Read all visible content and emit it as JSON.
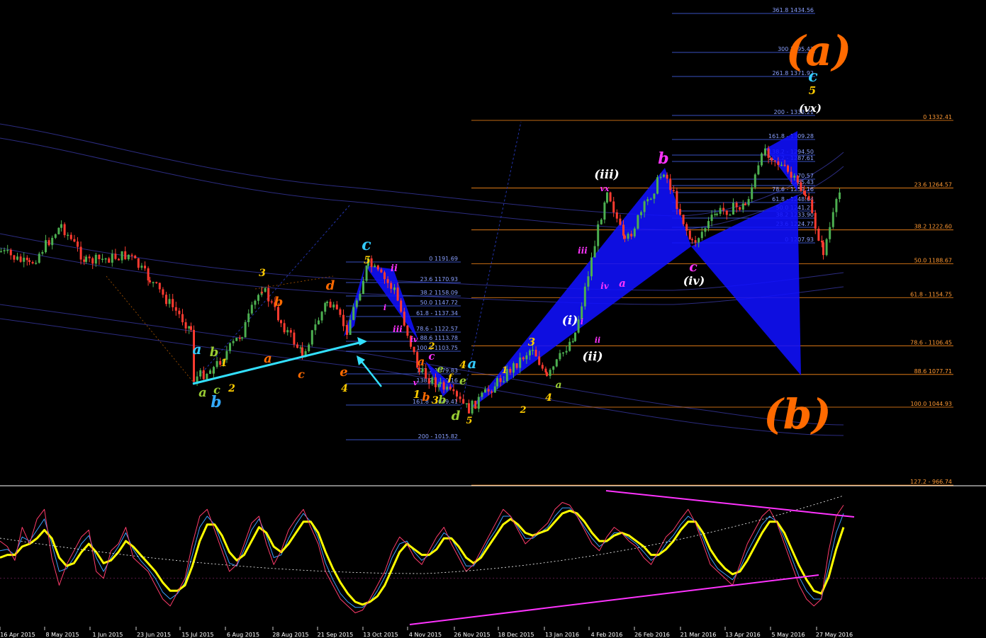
{
  "colors": {
    "background": "#000000",
    "bull_candle": "#4caf50",
    "bear_candle": "#ff3b30",
    "fib_orange": "#ff8c1a",
    "fib_blue": "#4a6cff",
    "fib_label": "#ff9933",
    "fib_label_blue": "#8aa0ff",
    "pattern_fill": "#1010ff",
    "channel": "#2a2a7a",
    "oscillator_main": "#ffff00",
    "oscillator_fast": "#3aa0ff",
    "oscillator_slow": "#ff3b6b",
    "oscillator_signal": "#ffffff",
    "divergence": "#ff33ff",
    "trend_arrow": "#33e0ff",
    "panel_divider": "#ffffff"
  },
  "chart_data": [
    {
      "type": "candlestick",
      "pane": "price",
      "y_range": [
        966,
        1434
      ],
      "big_labels": [
        {
          "text": "(a)",
          "color": "#ff6a00"
        },
        {
          "text": "(b)",
          "color": "#ff6a00"
        }
      ],
      "fib_right": [
        {
          "level": "0",
          "value": "1332.41",
          "label": "0 1332.41",
          "color": "#ff8c1a"
        },
        {
          "level": "23.6",
          "value": "1264.57",
          "label": "23.6 1264.57",
          "color": "#ff8c1a"
        },
        {
          "level": "38.2",
          "value": "1222.60",
          "label": "38.2 1222.60",
          "color": "#ff8c1a"
        },
        {
          "level": "50.0",
          "value": "1188.67",
          "label": "50.0 1188.67",
          "color": "#ff8c1a"
        },
        {
          "level": "61.8",
          "value": "1154.75",
          "label": "61.8 - 1154.75",
          "color": "#ff8c1a"
        },
        {
          "level": "78.6",
          "value": "1106.45",
          "label": "78.6 - 1106.45",
          "color": "#ff8c1a"
        },
        {
          "level": "88.6",
          "value": "1077.71",
          "label": "88.6 1077.71",
          "color": "#ff8c1a"
        },
        {
          "level": "100.0",
          "value": "1044.93",
          "label": "100.0 1044.93",
          "color": "#ff8c1a"
        },
        {
          "level": "127.2",
          "value": "966.74",
          "label": "127.2 - 966.74",
          "color": "#ff8c1a"
        }
      ],
      "fib_top": [
        {
          "label": "361.8 1434.56",
          "value": 1434.56
        },
        {
          "label": "300 1395.43",
          "value": 1395.43
        },
        {
          "label": "261.8 1371.92",
          "value": 1371.92
        },
        {
          "label": "200 - 1333.21",
          "value": 1333.21
        },
        {
          "label": "161.8 - 1309.28",
          "value": 1309.28
        },
        {
          "label": "138.2 - 1294.50",
          "value": 1294.5
        },
        {
          "label": "127.2 - 1287.61",
          "value": 1287.61
        },
        {
          "label": "1270.57",
          "value": 1270.57
        },
        {
          "label": "1265.43",
          "value": 1265.43
        },
        {
          "label": "78.6 - 1259.16",
          "value": 1259.16
        },
        {
          "label": "61.8 - 1248.64",
          "value": 1248.64
        },
        {
          "label": "50.0 1241.27",
          "value": 1241.27
        },
        {
          "label": "38.2 1233.90",
          "value": 1233.9
        },
        {
          "label": "23.6 1224.77",
          "value": 1224.77
        },
        {
          "label": "0 1207.93",
          "value": 1207.93
        }
      ],
      "fib_mid": [
        {
          "label": "0 1191.69",
          "value": 1191.69
        },
        {
          "label": "23.6 1170.93",
          "value": 1170.93
        },
        {
          "label": "38.2 1158.09",
          "value": 1158.09
        },
        {
          "label": "50.0 1147.72",
          "value": 1147.72
        },
        {
          "label": "61.8 - 1137.34",
          "value": 1137.34
        },
        {
          "label": "78.6 - 1122.57",
          "value": 1122.57
        },
        {
          "label": "88.6 1113.78",
          "value": 1113.78
        },
        {
          "label": "100.0 1103.75",
          "value": 1103.75
        },
        {
          "label": "127.2 1079.83",
          "value": 1079.83
        },
        {
          "label": "138.2 1070.16",
          "value": 1070.16
        },
        {
          "label": "161.8 - 1049.41",
          "value": 1049.41
        },
        {
          "label": "200 - 1015.82",
          "value": 1015.82
        }
      ],
      "wave_labels": [
        {
          "text": "a",
          "color": "#33ccff"
        },
        {
          "text": "b",
          "color": "#99cc33"
        },
        {
          "text": "1",
          "color": "#ffcc00"
        },
        {
          "text": "a",
          "color": "#99cc33"
        },
        {
          "text": "c",
          "color": "#99cc33"
        },
        {
          "text": "2",
          "color": "#ffcc00"
        },
        {
          "text": "b",
          "color": "#33aaff"
        },
        {
          "text": "3",
          "color": "#ffcc00"
        },
        {
          "text": "a",
          "color": "#ff6a00"
        },
        {
          "text": "b",
          "color": "#ff6a00"
        },
        {
          "text": "c",
          "color": "#ff6a00"
        },
        {
          "text": "d",
          "color": "#ff6a00"
        },
        {
          "text": "e",
          "color": "#ff6a00"
        },
        {
          "text": "4",
          "color": "#ffcc00"
        },
        {
          "text": "c",
          "color": "#33ccff"
        },
        {
          "text": "5",
          "color": "#ffcc00"
        },
        {
          "text": "ii",
          "color": "#ff33ff"
        },
        {
          "text": "i",
          "color": "#ff33ff"
        },
        {
          "text": "iii",
          "color": "#ff33ff"
        },
        {
          "text": "iv",
          "color": "#ff33ff"
        },
        {
          "text": "2",
          "color": "#ffcc00"
        },
        {
          "text": "a",
          "color": "#ff6a00"
        },
        {
          "text": "c",
          "color": "#ff33ff"
        },
        {
          "text": "v",
          "color": "#ff33ff"
        },
        {
          "text": "1",
          "color": "#ffcc00"
        },
        {
          "text": "b",
          "color": "#ff6a00"
        },
        {
          "text": "e",
          "color": "#99cc33"
        },
        {
          "text": "3",
          "color": "#ffcc00"
        },
        {
          "text": "b",
          "color": "#99cc33"
        },
        {
          "text": "4",
          "color": "#ffcc00"
        },
        {
          "text": "f",
          "color": "#ffcc00"
        },
        {
          "text": "e",
          "color": "#99cc33"
        },
        {
          "text": "a",
          "color": "#33ccff"
        },
        {
          "text": "d",
          "color": "#99cc33"
        },
        {
          "text": "5",
          "color": "#ffcc00"
        },
        {
          "text": "1",
          "color": "#ffcc00"
        },
        {
          "text": "2",
          "color": "#ffcc00"
        },
        {
          "text": "3",
          "color": "#ffcc00"
        },
        {
          "text": "4",
          "color": "#ffcc00"
        },
        {
          "text": "a",
          "color": "#99cc33"
        },
        {
          "text": "(i)",
          "color": "#ffffff"
        },
        {
          "text": "i",
          "color": "#ff33ff"
        },
        {
          "text": "ii",
          "color": "#ff33ff"
        },
        {
          "text": "(ii)",
          "color": "#ffffff"
        },
        {
          "text": "iii",
          "color": "#ff33ff"
        },
        {
          "text": "iv",
          "color": "#ff33ff"
        },
        {
          "text": "a",
          "color": "#ff33ff"
        },
        {
          "text": "(iii)",
          "color": "#ffffff"
        },
        {
          "text": "vx",
          "color": "#ff33ff"
        },
        {
          "text": "b",
          "color": "#ff33ff"
        },
        {
          "text": "c",
          "color": "#ff33ff"
        },
        {
          "text": "(iv)",
          "color": "#ffffff"
        },
        {
          "text": "c",
          "color": "#33ccff"
        },
        {
          "text": "5",
          "color": "#ffcc00"
        },
        {
          "text": "(vx)",
          "color": "#ffffff"
        }
      ]
    },
    {
      "type": "line",
      "pane": "oscillator",
      "series": [
        {
          "values": [
            62,
            58,
            48,
            72,
            60,
            78,
            85,
            50,
            30,
            45,
            55,
            65,
            70,
            40,
            35,
            55,
            60,
            72,
            50,
            45,
            40,
            30,
            20,
            15,
            25,
            35,
            60,
            80,
            85,
            70,
            55,
            40,
            45,
            60,
            75,
            80,
            60,
            45,
            55,
            70,
            78,
            85,
            72,
            60,
            40,
            30,
            20,
            15,
            10,
            12,
            20,
            30,
            40,
            55,
            65,
            60,
            50,
            45,
            55,
            65,
            72,
            60,
            50,
            40,
            45,
            55,
            65,
            75,
            85,
            80,
            70,
            60,
            65,
            70,
            75,
            85,
            90,
            88,
            80,
            70,
            60,
            55,
            65,
            72,
            68,
            62,
            58,
            50,
            45,
            55,
            65,
            70,
            78,
            85,
            75,
            60,
            45,
            40,
            35,
            30,
            45,
            60,
            70,
            80,
            85,
            75,
            60,
            45,
            30,
            20,
            15,
            20,
            55,
            80,
            88
          ]
        },
        {
          "values": [
            55,
            56,
            52,
            65,
            62,
            70,
            78,
            60,
            40,
            42,
            50,
            60,
            66,
            50,
            40,
            50,
            58,
            68,
            56,
            48,
            42,
            35,
            25,
            20,
            24,
            32,
            52,
            72,
            80,
            74,
            60,
            46,
            44,
            56,
            70,
            78,
            66,
            50,
            52,
            64,
            74,
            82,
            76,
            64,
            46,
            34,
            24,
            18,
            14,
            14,
            18,
            26,
            36,
            50,
            60,
            62,
            54,
            48,
            52,
            60,
            68,
            64,
            54,
            44,
            44,
            52,
            62,
            70,
            80,
            80,
            72,
            64,
            64,
            68,
            72,
            80,
            86,
            86,
            80,
            72,
            64,
            58,
            62,
            68,
            68,
            64,
            60,
            54,
            48,
            52,
            60,
            66,
            74,
            80,
            76,
            64,
            50,
            42,
            38,
            34,
            42,
            54,
            64,
            74,
            80,
            76,
            64,
            50,
            36,
            26,
            20,
            20,
            44,
            68,
            82
          ]
        },
        {
          "values": [
            50,
            52,
            52,
            58,
            60,
            64,
            70,
            64,
            50,
            44,
            46,
            54,
            60,
            54,
            46,
            48,
            54,
            62,
            58,
            52,
            46,
            40,
            32,
            26,
            26,
            30,
            44,
            62,
            74,
            74,
            66,
            54,
            48,
            52,
            62,
            72,
            68,
            58,
            54,
            60,
            68,
            76,
            76,
            68,
            54,
            42,
            32,
            24,
            18,
            16,
            18,
            22,
            30,
            42,
            54,
            60,
            56,
            52,
            52,
            56,
            64,
            64,
            58,
            50,
            46,
            50,
            58,
            66,
            74,
            78,
            74,
            68,
            66,
            68,
            70,
            76,
            82,
            84,
            82,
            76,
            68,
            62,
            62,
            66,
            68,
            66,
            62,
            58,
            52,
            52,
            56,
            62,
            70,
            76,
            76,
            68,
            56,
            48,
            42,
            38,
            40,
            48,
            58,
            68,
            76,
            76,
            68,
            56,
            44,
            34,
            26,
            24,
            36,
            56,
            72
          ]
        }
      ]
    }
  ],
  "date_labels": [
    "16 Apr 2015",
    "8 May 2015",
    "1 Jun 2015",
    "23 Jun 2015",
    "15 Jul 2015",
    "6 Aug 2015",
    "28 Aug 2015",
    "21 Sep 2015",
    "13 Oct 2015",
    "4 Nov 2015",
    "26 Nov 2015",
    "18 Dec 2015",
    "13 Jan 2016",
    "4 Feb 2016",
    "26 Feb 2016",
    "21 Mar 2016",
    "13 Apr 2016",
    "5 May 2016",
    "27 May 2016"
  ]
}
